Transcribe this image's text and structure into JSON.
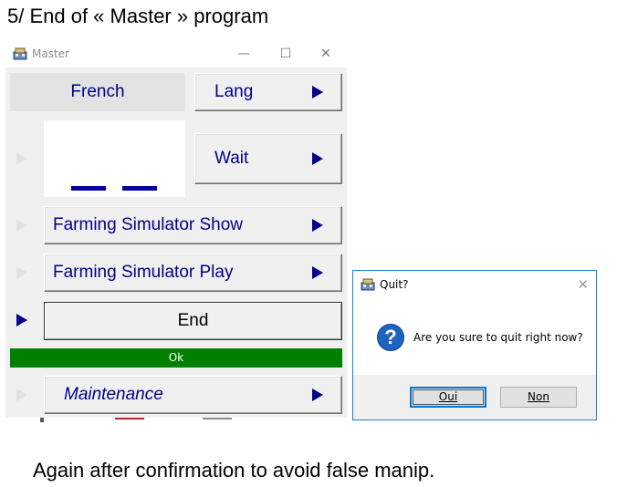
{
  "heading": "5/ End of « Master » program",
  "caption": "Again after confirmation to avoid false manip.",
  "master_window": {
    "title": "Master",
    "controls": {
      "minimize": "—",
      "maximize": "☐",
      "close": "✕"
    },
    "language_display": "French",
    "lang_button": "Lang",
    "wait_button": "Wait",
    "farming_show_button": "Farming Simulator Show",
    "farming_play_button": "Farming Simulator Play",
    "end_button": "End",
    "ok_status": "Ok",
    "maintenance_button": "Maintenance",
    "colors": {
      "label": "#00008b",
      "ok_bar": "#008000"
    }
  },
  "quit_dialog": {
    "title": "Quit?",
    "close": "✕",
    "icon": "?",
    "message": "Are you sure to quit right now?",
    "yes_button": "Oui",
    "no_button": "Non",
    "accent": "#1883d7"
  }
}
